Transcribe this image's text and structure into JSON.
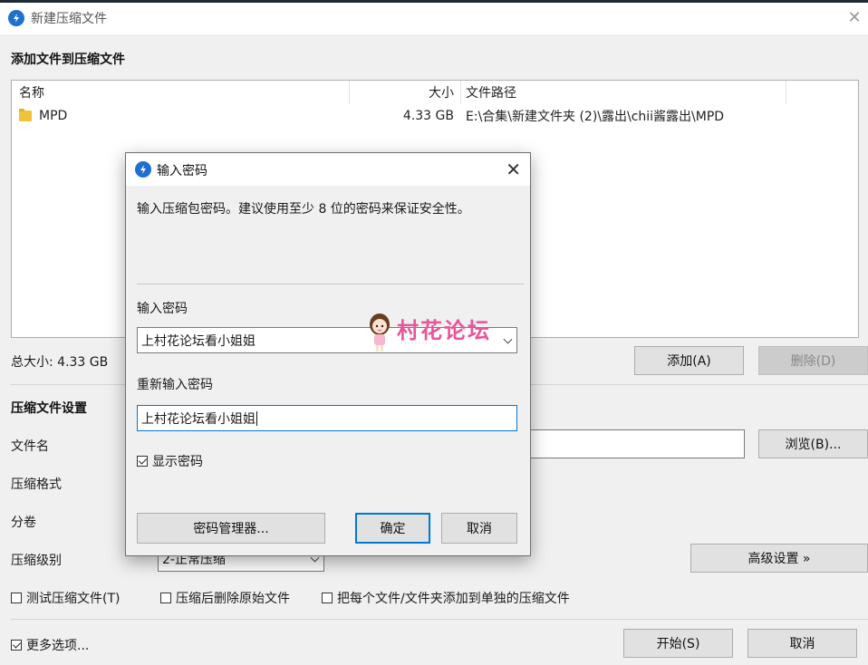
{
  "window": {
    "title": "新建压缩文件",
    "close_glyph": "✕"
  },
  "files_section": {
    "heading": "添加文件到压缩文件",
    "columns": {
      "name": "名称",
      "size": "大小",
      "path": "文件路径"
    },
    "rows": [
      {
        "name": "MPD",
        "size": "4.33 GB",
        "path": "E:\\合集\\新建文件夹 (2)\\露出\\chii酱露出\\MPD",
        "icon": "folder-icon"
      }
    ],
    "total_size": "总大小: 4.33 GB",
    "add_button": "添加(A)",
    "delete_button": "删除(D)"
  },
  "settings": {
    "heading": "压缩文件设置",
    "filename_label": "文件名",
    "browse_button": "浏览(B)...",
    "format_label": "压缩格式",
    "split_label": "分卷",
    "level_label": "压缩级别",
    "level_value": "2-正常压缩",
    "advanced_button": "高级设置 »",
    "test_checkbox": "测试压缩文件(T)",
    "delete_after_checkbox": "压缩后删除原始文件",
    "each_file_checkbox": "把每个文件/文件夹添加到单独的压缩文件",
    "more_options_checkbox": "更多选项...",
    "start_button": "开始(S)",
    "cancel_button": "取消"
  },
  "dialog": {
    "title": "输入密码",
    "description": "输入压缩包密码。建议使用至少 8 位的密码来保证安全性。",
    "password_label": "输入密码",
    "password_value": "上村花论坛看小姐姐",
    "confirm_label": "重新输入密码",
    "confirm_value": "上村花论坛看小姐姐",
    "show_password": "显示密码",
    "show_password_checked": true,
    "manager_button": "密码管理器...",
    "ok_button": "确定",
    "cancel_button": "取消",
    "close_glyph": "✕"
  },
  "watermark": {
    "text": "村花论坛"
  },
  "colors": {
    "accent": "#0078d7",
    "app_icon": "#1f6fd1",
    "watermark": "#e8559a"
  }
}
